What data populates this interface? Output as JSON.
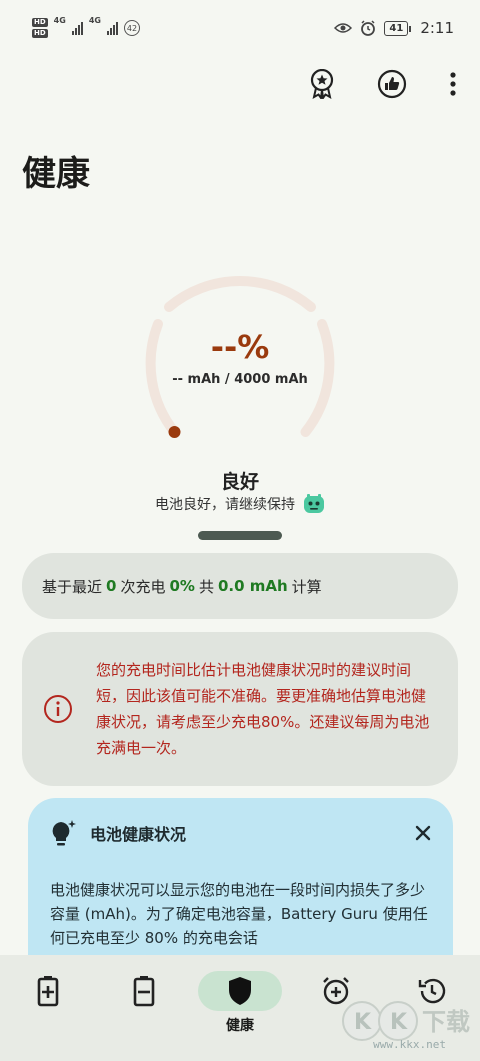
{
  "status_bar": {
    "hd_top": "HD",
    "hd_bottom": "HD",
    "net_1": "4G",
    "net_2": "4G",
    "notification_count": "42",
    "battery_level": "41",
    "time": "2:11"
  },
  "page": {
    "title": "健康"
  },
  "gauge": {
    "percent": "--%",
    "capacity": "-- mAh / 4000 mAh",
    "status": "良好",
    "subtitle": "电池良好，请继续保持",
    "fill_percent": 0
  },
  "stat_card": {
    "prefix": "基于最近",
    "cycles": "0",
    "cycles_suffix": "次充电",
    "percent": "0%",
    "total_label": "共",
    "total": "0.0 mAh",
    "suffix": "计算"
  },
  "warning": {
    "text": "您的充电时间比估计电池健康状况时的建议时间短，因此该值可能不准确。要更准确地估算电池健康状况，请考虑至少充电80%。还建议每周为电池充满电一次。"
  },
  "info_card": {
    "title": "电池健康状况",
    "body": "电池健康状况可以显示您的电池在一段时间内损失了多少容量 (mAh)。为了确定电池容量，Battery Guru 使用任何已充电至少 80% 的充电会话"
  },
  "bottom_nav": {
    "items": [
      {
        "label": ""
      },
      {
        "label": ""
      },
      {
        "label": "健康"
      },
      {
        "label": ""
      },
      {
        "label": ""
      }
    ]
  },
  "watermark": {
    "logo": "KK下载",
    "url": "www.kkx.net"
  },
  "colors": {
    "accent_orange": "#9a3a0e",
    "warning_red": "#b3261e",
    "success_green": "#1f7a22",
    "info_blue": "#bfe6f3"
  }
}
